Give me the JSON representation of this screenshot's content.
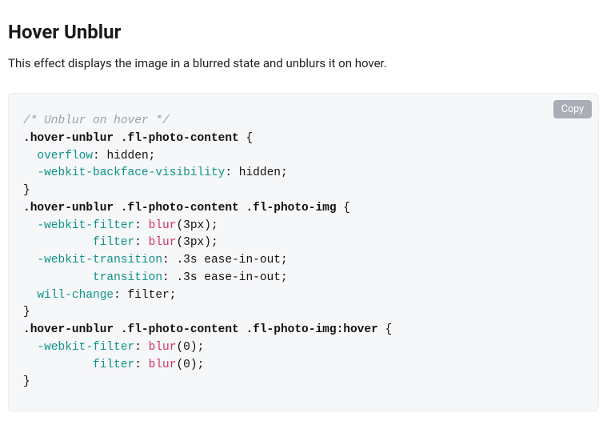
{
  "heading": "Hover Unblur",
  "description": "This effect displays the image in a blurred state and unblurs it on hover.",
  "copy_label": "Copy",
  "code": {
    "comment": "/* Unblur on hover */",
    "rules": [
      {
        "selector": ".hover-unblur .fl-photo-content",
        "declarations": [
          {
            "property": "overflow",
            "value": "hidden"
          },
          {
            "property": "-webkit-backface-visibility",
            "value": "hidden"
          }
        ]
      },
      {
        "selector": ".hover-unblur .fl-photo-content .fl-photo-img",
        "declarations": [
          {
            "property": "-webkit-filter",
            "func": "blur",
            "args": "3px",
            "indent": 2
          },
          {
            "property": "filter",
            "func": "blur",
            "args": "3px",
            "indent": 10
          },
          {
            "property": "-webkit-transition",
            "value": ".3s ease-in-out",
            "indent": 2
          },
          {
            "property": "transition",
            "value": ".3s ease-in-out",
            "indent": 10
          },
          {
            "property": "will-change",
            "value": "filter",
            "indent": 2
          }
        ]
      },
      {
        "selector": ".hover-unblur .fl-photo-content .fl-photo-img:hover",
        "declarations": [
          {
            "property": "-webkit-filter",
            "func": "blur",
            "args": "0",
            "indent": 2
          },
          {
            "property": "filter",
            "func": "blur",
            "args": "0",
            "indent": 10
          }
        ]
      }
    ]
  }
}
